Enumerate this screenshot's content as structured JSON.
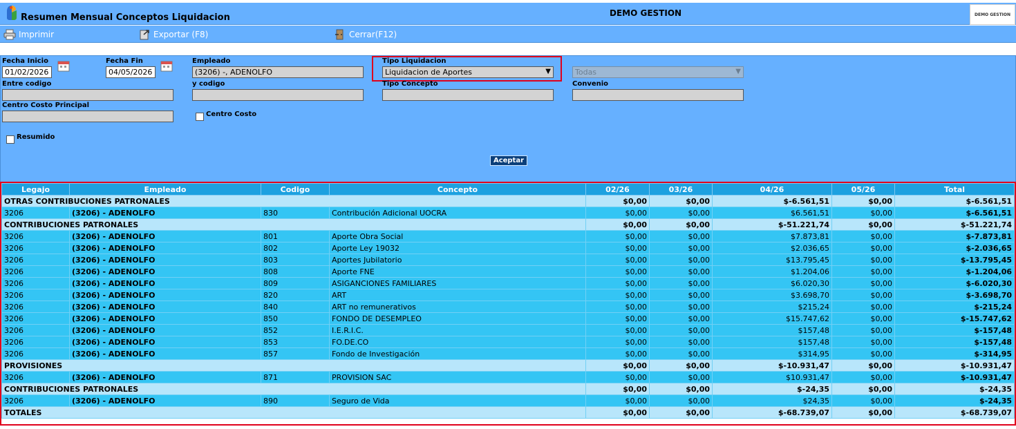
{
  "window": {
    "title": "Resumen Mensual Conceptos Liquidacion",
    "center_title": "DEMO GESTION",
    "brand": "DEMO GESTION"
  },
  "toolbar": {
    "print_label": "Imprimir",
    "export_label": "Exportar (F8)",
    "close_label": "Cerrar(F12)"
  },
  "filters": {
    "fecha_inicio_label": "Fecha Inicio",
    "fecha_inicio_value": "01/02/2026",
    "fecha_fin_label": "Fecha Fin",
    "fecha_fin_value": "04/05/2026",
    "empleado_label": "Empleado",
    "empleado_value": "(3206) -, ADENOLFO",
    "tipo_liquidacion_label": "Tipo Liquidacion",
    "tipo_liquidacion_value": "Liquidacion de Aportes",
    "todas_value": "Todas",
    "entre_codigo_label": "Entre codigo",
    "y_codigo_label": "y codigo",
    "tipo_concepto_label": "Tipo Concepto",
    "convenio_label": "Convenio",
    "centro_costo_principal_label": "Centro Costo Principal",
    "centro_costo_label": "Centro Costo",
    "resumido_label": "Resumido",
    "accept_label": "Aceptar"
  },
  "grid": {
    "columns": [
      "Legajo",
      "Empleado",
      "Codigo",
      "Concepto",
      "02/26",
      "03/26",
      "04/26",
      "05/26",
      "Total"
    ],
    "rows": [
      {
        "type": "grp",
        "label": "OTRAS CONTRIBUCIONES PATRONALES",
        "m1": "$0,00",
        "m2": "$0,00",
        "m3": "$-6.561,51",
        "m4": "$0,00",
        "total": "$-6.561,51"
      },
      {
        "type": "det",
        "legajo": "3206",
        "empleado": "(3206) - ADENOLFO",
        "codigo": "830",
        "concepto": "Contribución Adicional UOCRA",
        "m1": "$0,00",
        "m2": "$0,00",
        "m3": "$6.561,51",
        "m4": "$0,00",
        "total": "$-6.561,51"
      },
      {
        "type": "grp",
        "label": "CONTRIBUCIONES PATRONALES",
        "m1": "$0,00",
        "m2": "$0,00",
        "m3": "$-51.221,74",
        "m4": "$0,00",
        "total": "$-51.221,74"
      },
      {
        "type": "det",
        "legajo": "3206",
        "empleado": "(3206) - ADENOLFO",
        "codigo": "801",
        "concepto": "Aporte Obra Social",
        "m1": "$0,00",
        "m2": "$0,00",
        "m3": "$7.873,81",
        "m4": "$0,00",
        "total": "$-7.873,81"
      },
      {
        "type": "det",
        "legajo": "3206",
        "empleado": "(3206) - ADENOLFO",
        "codigo": "802",
        "concepto": "Aporte Ley 19032",
        "m1": "$0,00",
        "m2": "$0,00",
        "m3": "$2.036,65",
        "m4": "$0,00",
        "total": "$-2.036,65"
      },
      {
        "type": "det",
        "legajo": "3206",
        "empleado": "(3206) - ADENOLFO",
        "codigo": "803",
        "concepto": "Aportes Jubilatorio",
        "m1": "$0,00",
        "m2": "$0,00",
        "m3": "$13.795,45",
        "m4": "$0,00",
        "total": "$-13.795,45"
      },
      {
        "type": "det",
        "legajo": "3206",
        "empleado": "(3206) - ADENOLFO",
        "codigo": "808",
        "concepto": "Aporte FNE",
        "m1": "$0,00",
        "m2": "$0,00",
        "m3": "$1.204,06",
        "m4": "$0,00",
        "total": "$-1.204,06"
      },
      {
        "type": "det",
        "legajo": "3206",
        "empleado": "(3206) - ADENOLFO",
        "codigo": "809",
        "concepto": "ASIGANCIONES FAMILIARES",
        "m1": "$0,00",
        "m2": "$0,00",
        "m3": "$6.020,30",
        "m4": "$0,00",
        "total": "$-6.020,30"
      },
      {
        "type": "det",
        "legajo": "3206",
        "empleado": "(3206) - ADENOLFO",
        "codigo": "820",
        "concepto": "ART",
        "m1": "$0,00",
        "m2": "$0,00",
        "m3": "$3.698,70",
        "m4": "$0,00",
        "total": "$-3.698,70"
      },
      {
        "type": "det",
        "legajo": "3206",
        "empleado": "(3206) - ADENOLFO",
        "codigo": "840",
        "concepto": "ART no remunerativos",
        "m1": "$0,00",
        "m2": "$0,00",
        "m3": "$215,24",
        "m4": "$0,00",
        "total": "$-215,24"
      },
      {
        "type": "det",
        "legajo": "3206",
        "empleado": "(3206) - ADENOLFO",
        "codigo": "850",
        "concepto": "FONDO DE DESEMPLEO",
        "m1": "$0,00",
        "m2": "$0,00",
        "m3": "$15.747,62",
        "m4": "$0,00",
        "total": "$-15.747,62"
      },
      {
        "type": "det",
        "legajo": "3206",
        "empleado": "(3206) - ADENOLFO",
        "codigo": "852",
        "concepto": "I.E.R.I.C.",
        "m1": "$0,00",
        "m2": "$0,00",
        "m3": "$157,48",
        "m4": "$0,00",
        "total": "$-157,48"
      },
      {
        "type": "det",
        "legajo": "3206",
        "empleado": "(3206) - ADENOLFO",
        "codigo": "853",
        "concepto": "FO.DE.CO",
        "m1": "$0,00",
        "m2": "$0,00",
        "m3": "$157,48",
        "m4": "$0,00",
        "total": "$-157,48"
      },
      {
        "type": "det",
        "legajo": "3206",
        "empleado": "(3206) - ADENOLFO",
        "codigo": "857",
        "concepto": "Fondo de Investigación",
        "m1": "$0,00",
        "m2": "$0,00",
        "m3": "$314,95",
        "m4": "$0,00",
        "total": "$-314,95"
      },
      {
        "type": "grp",
        "label": "PROVISIONES",
        "m1": "$0,00",
        "m2": "$0,00",
        "m3": "$-10.931,47",
        "m4": "$0,00",
        "total": "$-10.931,47"
      },
      {
        "type": "det",
        "legajo": "3206",
        "empleado": "(3206) - ADENOLFO",
        "codigo": "871",
        "concepto": "PROVISION SAC",
        "m1": "$0,00",
        "m2": "$0,00",
        "m3": "$10.931,47",
        "m4": "$0,00",
        "total": "$-10.931,47"
      },
      {
        "type": "grp",
        "label": "CONTRIBUCIONES PATRONALES",
        "m1": "$0,00",
        "m2": "$0,00",
        "m3": "$-24,35",
        "m4": "$0,00",
        "total": "$-24,35"
      },
      {
        "type": "det",
        "legajo": "3206",
        "empleado": "(3206) - ADENOLFO",
        "codigo": "890",
        "concepto": "Seguro de Vida",
        "m1": "$0,00",
        "m2": "$0,00",
        "m3": "$24,35",
        "m4": "$0,00",
        "total": "$-24,35"
      },
      {
        "type": "tot",
        "label": "TOTALES",
        "m1": "$0,00",
        "m2": "$0,00",
        "m3": "$-68.739,07",
        "m4": "$0,00",
        "total": "$-68.739,07"
      }
    ]
  },
  "colors": {
    "panel": "#66b0ff",
    "header": "#1da1e0",
    "group_row": "#b8e6fb",
    "detail_row": "#34c5f4",
    "highlight": "#e0001b"
  }
}
